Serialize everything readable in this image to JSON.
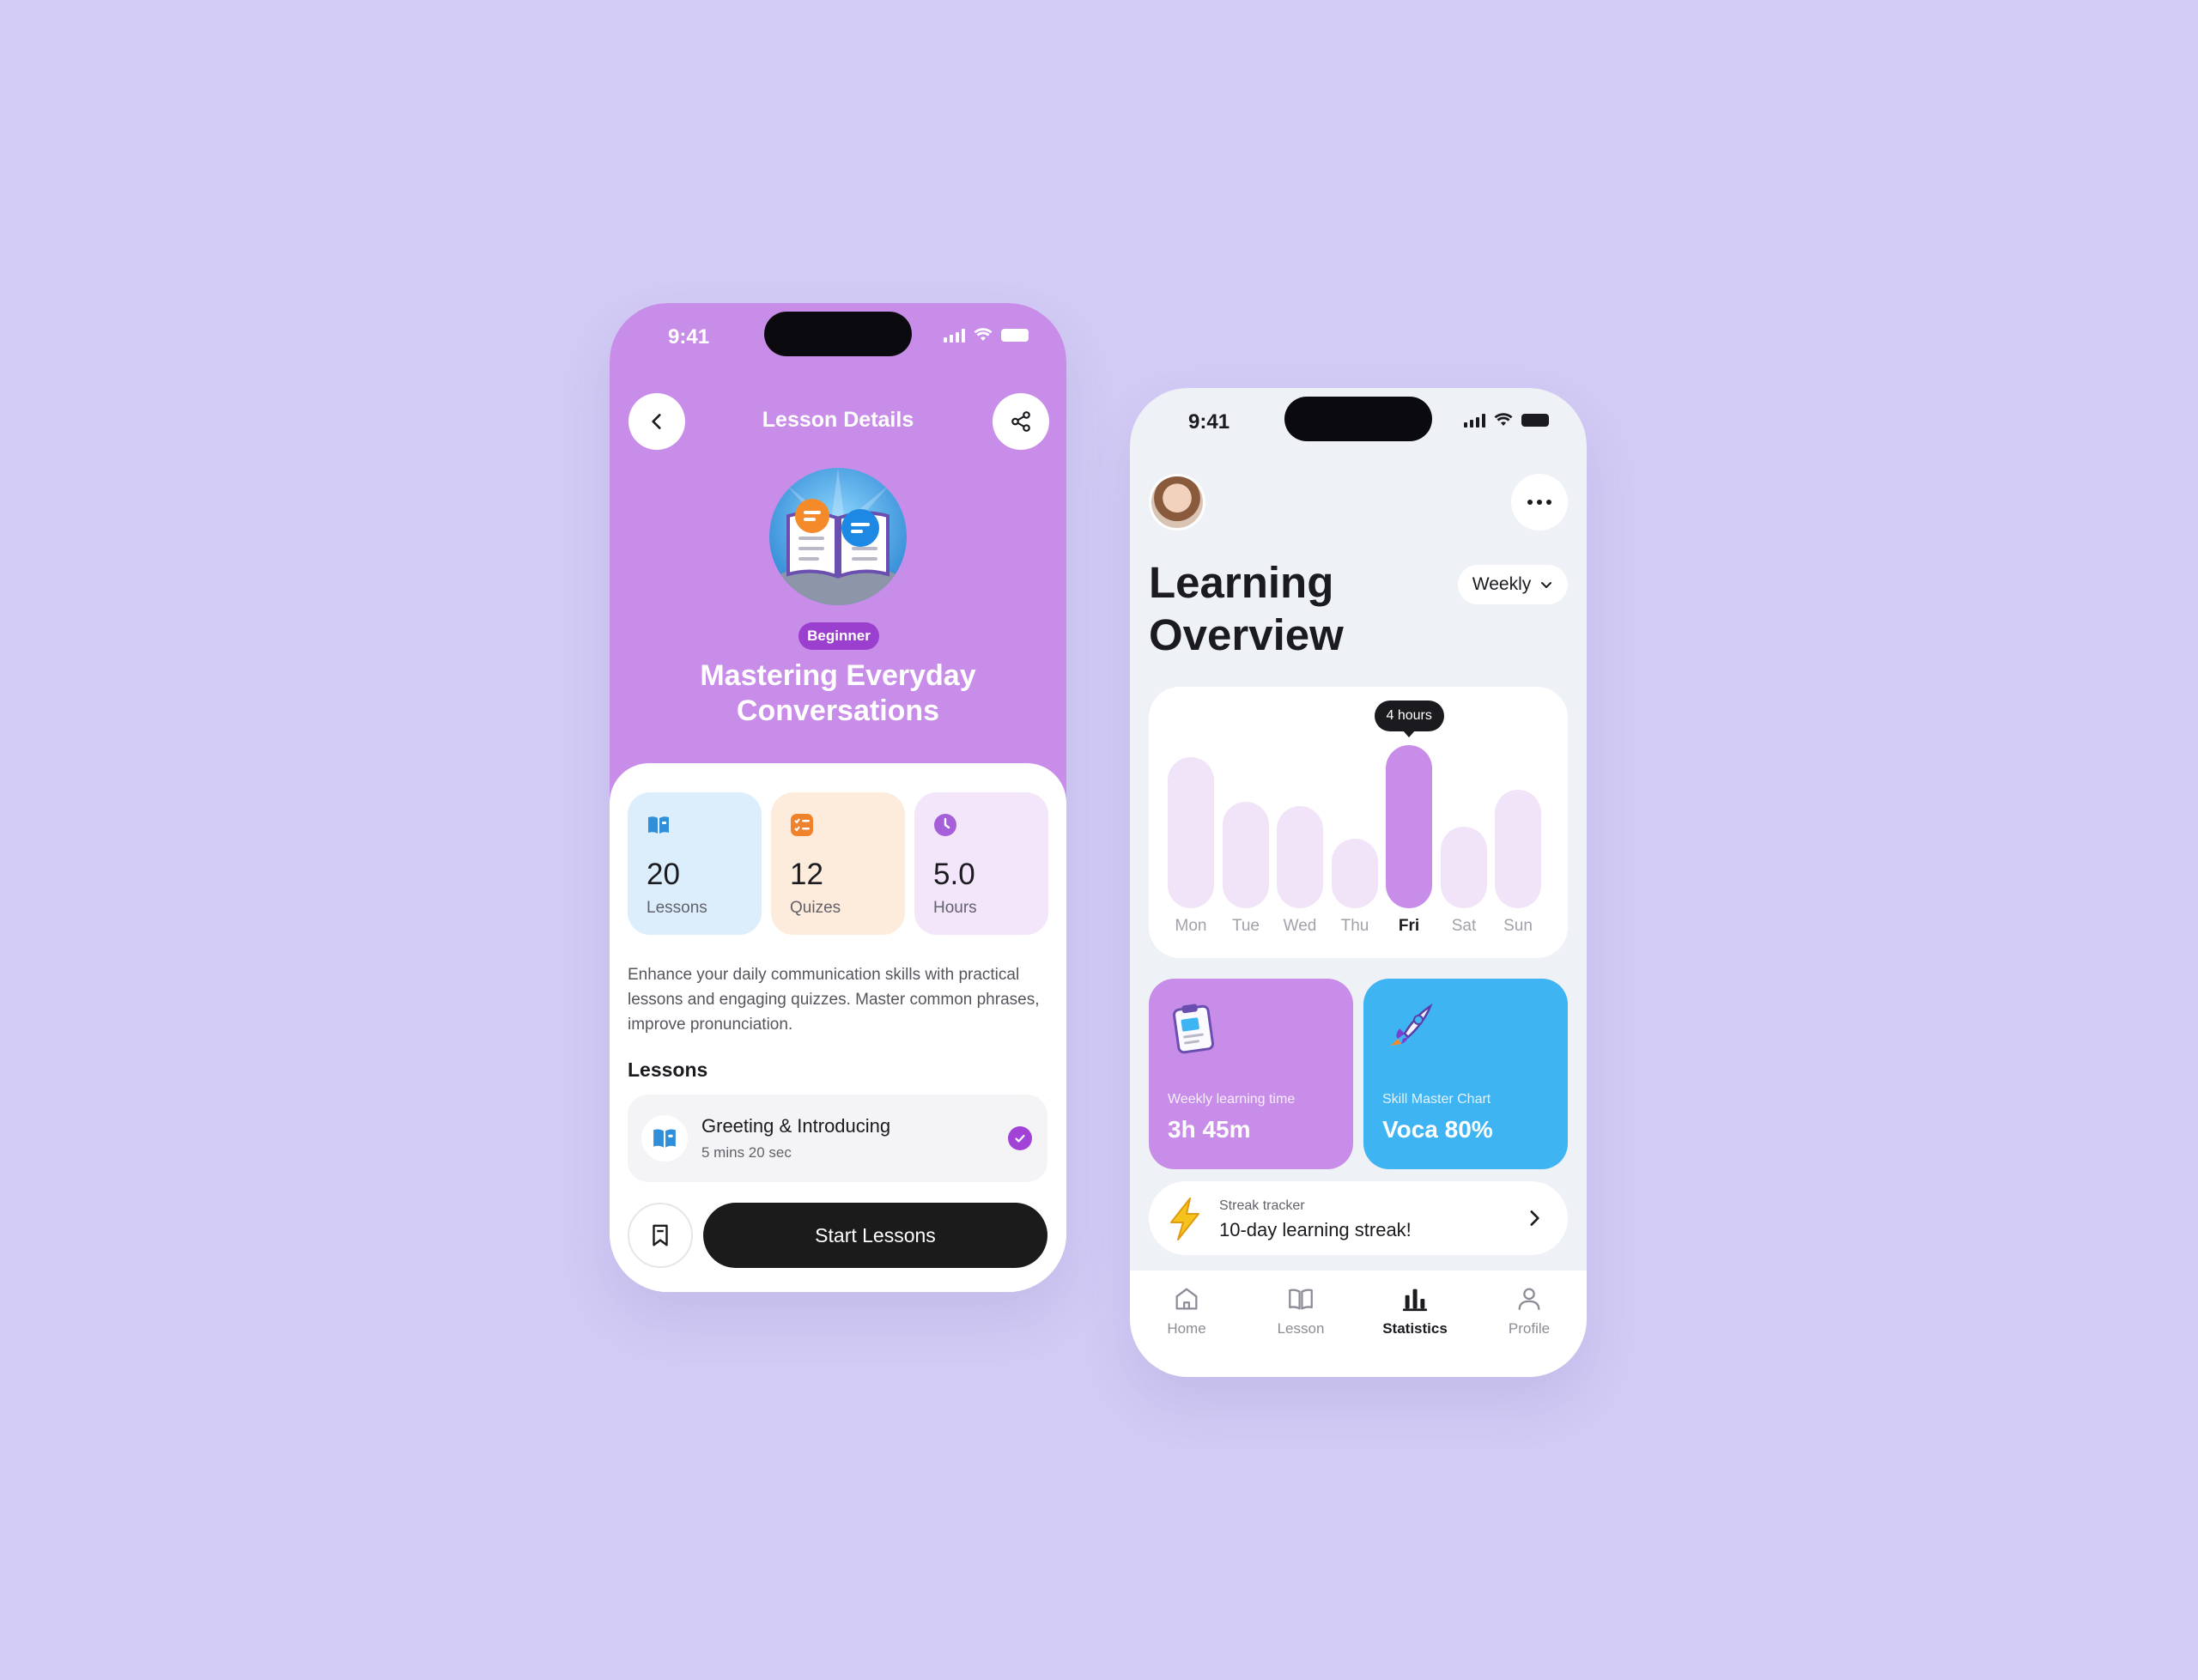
{
  "lesson_screen": {
    "status_time": "9:41",
    "header_title": "Lesson Details",
    "level_badge": "Beginner",
    "course_title": "Mastering Everyday Conversations",
    "stats": [
      {
        "value": "20",
        "label": "Lessons",
        "icon": "book-icon",
        "bg": "#dceefc",
        "icon_color": "#2f8fd8"
      },
      {
        "value": "12",
        "label": "Quizes",
        "icon": "checklist-icon",
        "bg": "#fdebdc",
        "icon_color": "#f0822c"
      },
      {
        "value": "5.0",
        "label": "Hours",
        "icon": "clock-icon",
        "bg": "#f3e6fb",
        "icon_color": "#a45fd9"
      }
    ],
    "description": "Enhance your daily communication skills with practical lessons and engaging quizzes. Master common phrases, improve pronunciation.",
    "lessons_heading": "Lessons",
    "lesson_item": {
      "title": "Greeting & Introducing",
      "duration": "5 mins 20 sec",
      "completed": true
    },
    "start_button": "Start Lessons",
    "accent_color": "#c88de8"
  },
  "overview_screen": {
    "status_time": "9:41",
    "title": "Learning Overview",
    "period_select": "Weekly",
    "chart_data": {
      "type": "bar",
      "categories": [
        "Mon",
        "Tue",
        "Wed",
        "Thu",
        "Fri",
        "Sat",
        "Sun"
      ],
      "values": [
        3.7,
        2.6,
        2.5,
        1.7,
        4.0,
        2.0,
        2.9
      ],
      "highlighted": "Fri",
      "tooltip": "4 hours"
    },
    "weekly_time": {
      "caption": "Weekly learning time",
      "value": "3h 45m",
      "color": "#c88de8"
    },
    "skill_master": {
      "caption": "Skill Master Chart",
      "value": "Voca 80%",
      "color": "#3fb4f2"
    },
    "streak": {
      "caption": "Streak tracker",
      "value": "10-day learning streak!"
    },
    "tabs": [
      {
        "label": "Home",
        "icon": "home-icon",
        "active": false
      },
      {
        "label": "Lesson",
        "icon": "book-icon",
        "active": false
      },
      {
        "label": "Statistics",
        "icon": "bar-chart-icon",
        "active": true
      },
      {
        "label": "Profile",
        "icon": "user-icon",
        "active": false
      }
    ]
  }
}
